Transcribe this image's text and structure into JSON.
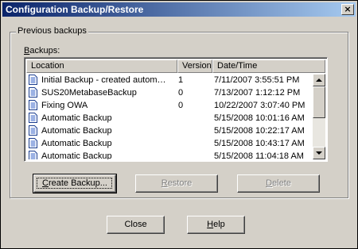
{
  "window": {
    "title": "Configuration Backup/Restore",
    "close_glyph": "×"
  },
  "group": {
    "legend": "Previous backups"
  },
  "backups_label": {
    "first": "B",
    "rest": "ackups:"
  },
  "columns": [
    "Location",
    "Version",
    "Date/Time"
  ],
  "rows": [
    {
      "location": "Initial Backup - created autom…",
      "version": "1",
      "date": "7/11/2007 3:55:51 PM",
      "icon": "document-icon"
    },
    {
      "location": "SUS20MetabaseBackup",
      "version": "0",
      "date": "7/13/2007 1:12:12 PM",
      "icon": "document-icon"
    },
    {
      "location": "Fixing OWA",
      "version": "0",
      "date": "10/22/2007 3:07:40 PM",
      "icon": "document-icon"
    },
    {
      "location": "Automatic Backup",
      "version": "",
      "date": "5/15/2008 10:01:16 AM",
      "icon": "document-icon"
    },
    {
      "location": "Automatic Backup",
      "version": "",
      "date": "5/15/2008 10:22:17 AM",
      "icon": "document-icon"
    },
    {
      "location": "Automatic Backup",
      "version": "",
      "date": "5/15/2008 10:43:17 AM",
      "icon": "document-icon"
    },
    {
      "location": "Automatic Backup",
      "version": "",
      "date": "5/15/2008 11:04:18 AM",
      "icon": "document-icon"
    }
  ],
  "buttons": {
    "create": {
      "first": "C",
      "rest": "reate Backup..."
    },
    "restore": {
      "first": "R",
      "rest": "estore"
    },
    "delete": {
      "first": "D",
      "rest": "elete"
    },
    "close": "Close",
    "help": {
      "first": "H",
      "rest": "elp"
    }
  },
  "colors": {
    "titlebar_start": "#0a246a",
    "titlebar_end": "#a6caf0",
    "face": "#d4d0c8"
  }
}
